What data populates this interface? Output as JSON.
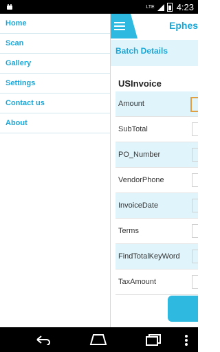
{
  "status": {
    "network": "LTE",
    "time": "4:23"
  },
  "drawer": {
    "items": [
      "Home",
      "Scan",
      "Gallery",
      "Settings",
      "Contact us",
      "About"
    ]
  },
  "app": {
    "title": "Ephesoft",
    "section": "Batch Details",
    "document_type": "USInvoice"
  },
  "fields": [
    "Amount",
    "SubTotal",
    "PO_Number",
    "VendorPhone",
    "InvoiceDate",
    "Terms",
    "FindTotalKeyWord",
    "TaxAmount"
  ],
  "colors": {
    "accent": "#2eb9e0",
    "light": "#dff4fb",
    "text_accent": "#1aa7d7"
  },
  "icons": [
    "android-icon",
    "signal-icon",
    "battery-icon",
    "hamburger-icon",
    "back-icon",
    "home-icon",
    "recent-apps-icon",
    "menu-dots-icon"
  ]
}
